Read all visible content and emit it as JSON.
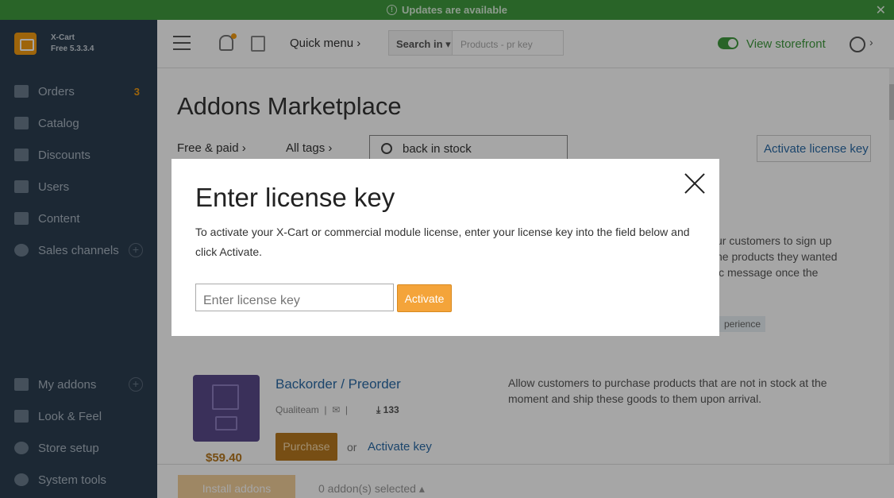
{
  "banner": {
    "text": "Updates are available",
    "close": "✕"
  },
  "brand": {
    "name": "X-Cart",
    "version": "Free 5.3.3.4"
  },
  "sidebar": {
    "items": [
      {
        "label": "Orders",
        "count": "3"
      },
      {
        "label": "Catalog"
      },
      {
        "label": "Discounts"
      },
      {
        "label": "Users"
      },
      {
        "label": "Content"
      },
      {
        "label": "Sales channels",
        "plus": "+"
      }
    ],
    "bottom_items": [
      {
        "label": "My addons",
        "plus": "+"
      },
      {
        "label": "Look & Feel"
      },
      {
        "label": "Store setup"
      },
      {
        "label": "System tools"
      }
    ]
  },
  "header": {
    "quick_menu": "Quick menu",
    "search_in": "Search in",
    "search_placeholder": "Products - pr key",
    "view_storefront": "View storefront"
  },
  "main": {
    "title": "Addons Marketplace",
    "filter_price": "Free & paid",
    "filter_tags": "All tags",
    "search_value": "back in stock",
    "activate_license": "Activate license key",
    "peek_lines": [
      "ur customers to sign up",
      "he products they wanted",
      "ic message once the"
    ],
    "peek_tag": "perience"
  },
  "product": {
    "name": "Backorder / Preorder",
    "vendor": "Qualiteam",
    "downloads": "133",
    "price": "$59.40",
    "purchase": "Purchase",
    "or": "or",
    "activate_key": "Activate key",
    "description": "Allow customers to purchase products that are not in stock at the moment and ship these goods to them upon arrival."
  },
  "bottombar": {
    "install": "Install addons",
    "selected": "0 addon(s) selected"
  },
  "modal": {
    "title": "Enter license key",
    "text": "To activate your X-Cart or commercial module license, enter your license key into the field below and click Activate.",
    "placeholder": "Enter license key",
    "button": "Activate"
  }
}
